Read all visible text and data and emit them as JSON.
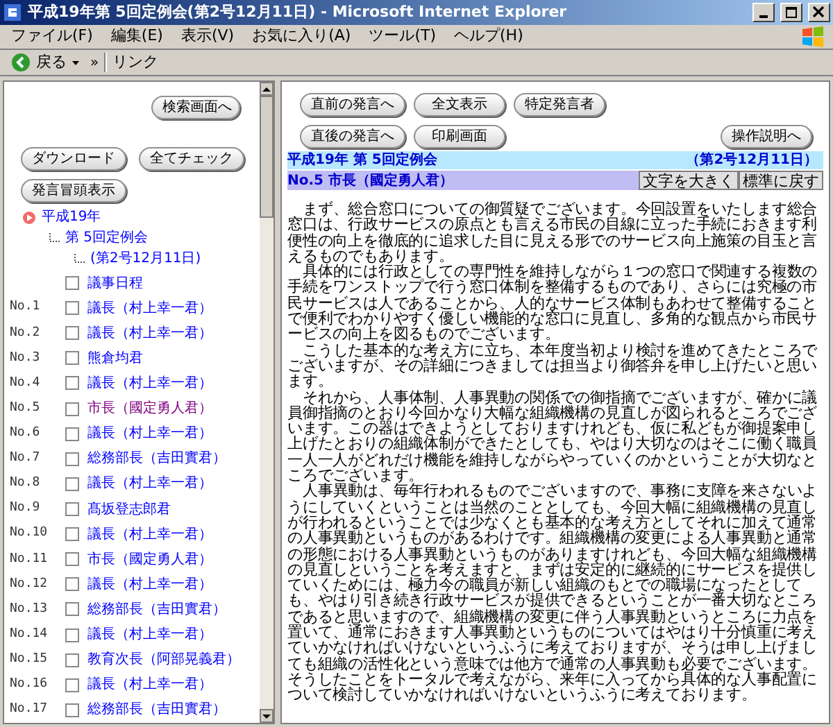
{
  "window": {
    "title": "平成19年第 5回定例会(第2号12月11日) - Microsoft Internet Explorer"
  },
  "menu": [
    "ファイル(F)",
    "編集(E)",
    "表示(V)",
    "お気に入り(A)",
    "ツール(T)",
    "ヘルプ(H)"
  ],
  "toolbar": {
    "back": "戻る",
    "more": "»",
    "links": "リンク"
  },
  "left": {
    "search_button": "検索画面へ",
    "buttons": [
      "ダウンロード",
      "全てチェック",
      "発言冒頭表示"
    ],
    "tree": {
      "label": "平成19年",
      "children": [
        {
          "label": "第 5回定例会",
          "children": [
            {
              "label": "(第2号12月11日)"
            }
          ]
        }
      ]
    },
    "items": [
      {
        "label": "議事日程",
        "checked": false,
        "visited": false
      },
      {
        "number": "No.1",
        "label": "議長（村上幸一君）",
        "checked": false,
        "visited": false
      },
      {
        "number": "No.2",
        "label": "議長（村上幸一君）",
        "checked": false,
        "visited": false
      },
      {
        "number": "No.3",
        "label": "熊倉均君",
        "checked": false,
        "visited": false
      },
      {
        "number": "No.4",
        "label": "議長（村上幸一君）",
        "checked": false,
        "visited": false
      },
      {
        "number": "No.5",
        "label": "市長（國定勇人君）",
        "checked": false,
        "visited": true
      },
      {
        "number": "No.6",
        "label": "議長（村上幸一君）",
        "checked": false,
        "visited": false
      },
      {
        "number": "No.7",
        "label": "総務部長（吉田實君）",
        "checked": false,
        "visited": false
      },
      {
        "number": "No.8",
        "label": "議長（村上幸一君）",
        "checked": false,
        "visited": false
      },
      {
        "number": "No.9",
        "label": "髙坂登志郎君",
        "checked": false,
        "visited": false
      },
      {
        "number": "No.10",
        "label": "議長（村上幸一君）",
        "checked": false,
        "visited": false
      },
      {
        "number": "No.11",
        "label": "市長（國定勇人君）",
        "checked": false,
        "visited": false
      },
      {
        "number": "No.12",
        "label": "議長（村上幸一君）",
        "checked": false,
        "visited": false
      },
      {
        "number": "No.13",
        "label": "総務部長（吉田實君）",
        "checked": false,
        "visited": false
      },
      {
        "number": "No.14",
        "label": "議長（村上幸一君）",
        "checked": false,
        "visited": false
      },
      {
        "number": "No.15",
        "label": "教育次長（阿部晃義君）",
        "checked": false,
        "visited": false
      },
      {
        "number": "No.16",
        "label": "議長（村上幸一君）",
        "checked": false,
        "visited": false
      },
      {
        "number": "No.17",
        "label": "総務部長（吉田實君）",
        "checked": false,
        "visited": false
      }
    ]
  },
  "right": {
    "buttons_row1": [
      "直前の発言へ",
      "全文表示",
      "特定発言者"
    ],
    "buttons_row2": [
      "直後の発言へ",
      "印刷画面"
    ],
    "help_button": "操作説明へ",
    "session": "平成19年 第 5回定例会",
    "date": "（第2号12月11日）",
    "speaker": "No.5 市長（國定勇人君）",
    "font_buttons": [
      "文字を大きく",
      "標準に戻す"
    ],
    "paragraphs": [
      "まず、総合窓口についての御質疑でございます。今回設置をいたします総合窓口は、行政サービスの原点とも言える市民の目線に立った手続におきます利便性の向上を徹底的に追求した目に見える形でのサービス向上施策の目玉と言えるものでもあります。",
      "具体的には行政としての専門性を維持しながら１つの窓口で関連する複数の手続をワンストップで行う窓口体制を整備するものであり、さらには究極の市民サービスは人であることから、人的なサービス体制もあわせて整備することで便利でわかりやすく優しい機能的な窓口に見直し、多角的な観点から市民サービスの向上を図るものでございます。",
      "こうした基本的な考え方に立ち、本年度当初より検討を進めてきたところでございますが、その詳細につきましては担当より御答弁を申し上げたいと思います。",
      "それから、人事体制、人事異動の関係での御指摘でございますが、確かに議員御指摘のとおり今回かなり大幅な組織機構の見直しが図られるところでございます。この器はできようとしておりますけれども、仮に私どもが御提案申し上げたとおりの組織体制ができたとしても、やはり大切なのはそこに働く職員一人一人がどれだけ機能を維持しながらやっていくのかということが大切なところでございます。",
      "人事異動は、毎年行われるものでございますので、事務に支障を来さないようにしていくということは当然のこととしても、今回大幅に組織機構の見直しが行われるということでは少なくとも基本的な考え方としてそれに加えて通常の人事異動というものがあるわけです。組織機構の変更による人事異動と通常の形態における人事異動というものがありますけれども、今回大幅な組織機構の見直しということを考えますと、まずは安定的に継続的にサービスを提供していくためには、極力今の職員が新しい組織のもとでの職場になったとしても、やはり引き続き行政サービスが提供できるということが一番大切なところであると思いますので、組織機構の変更に伴う人事異動というところに力点を置いて、通常におきます人事異動というものについてはやはり十分慎重に考えていかなければいけないというふうに考えておりますが、そうは申し上げましても組織の活性化という意味では他方で通常の人事異動も必要でございます。そうしたことをトータルで考えながら、来年に入ってから具体的な人事配置について検討していかなければいけないというふうに考えております。"
    ]
  }
}
